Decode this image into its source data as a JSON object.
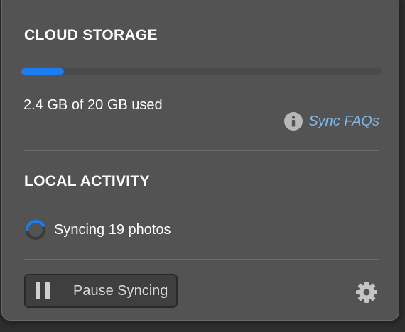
{
  "cloud_storage": {
    "title": "CLOUD STORAGE",
    "used_fraction": 0.12,
    "usage_text": "2.4 GB of 20 GB used",
    "faq_link_label": "Sync FAQs",
    "faq_icon": "info-icon"
  },
  "local_activity": {
    "title": "LOCAL ACTIVITY",
    "status_text": "Syncing 19 photos",
    "status_icon": "spinner-icon"
  },
  "footer": {
    "pause_button_label": "Pause Syncing",
    "pause_icon": "pause-icon",
    "settings_icon": "gear-icon"
  },
  "colors": {
    "panel_bg": "#535353",
    "progress_fill": "#1a7ef0",
    "link": "#7fb7ea",
    "text": "#ffffff"
  }
}
